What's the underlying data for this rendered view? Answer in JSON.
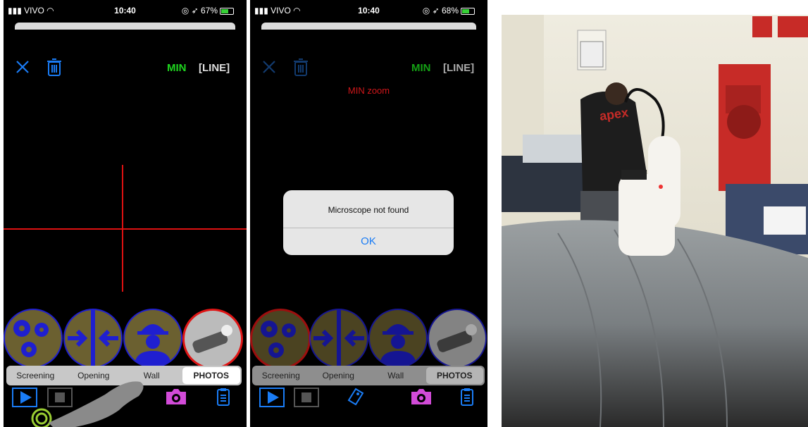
{
  "status": {
    "carrier": "VIVO",
    "time": "10:40",
    "battery1": "67%",
    "battery2": "68%"
  },
  "header": {
    "min_label": "MIN",
    "line_label": "[LINE]"
  },
  "zoom_warning": "MIN zoom",
  "alert": {
    "message": "Microscope not found",
    "ok_label": "OK"
  },
  "tabs": [
    {
      "label": "Screening"
    },
    {
      "label": "Opening"
    },
    {
      "label": "Wall"
    },
    {
      "label": "PHOTOS"
    }
  ],
  "photo": {
    "logo_text": "apex"
  },
  "colors": {
    "accent_blue": "#1a7cf5",
    "min_green": "#1fd61f",
    "crosshair_red": "#d11111",
    "camera_magenta": "#d24bd8"
  }
}
